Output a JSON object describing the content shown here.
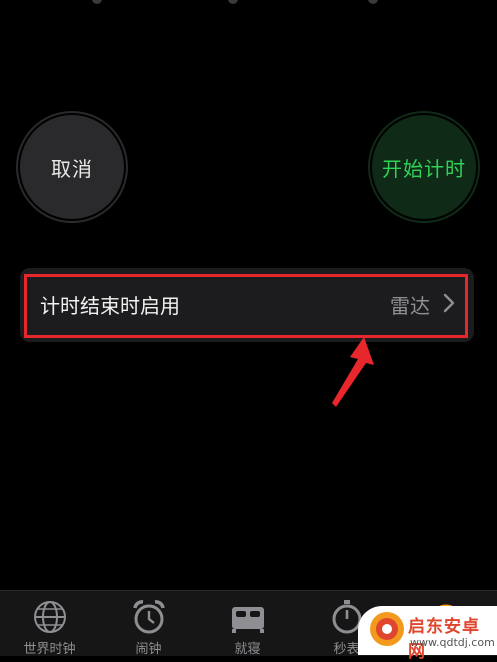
{
  "buttons": {
    "cancel_label": "取消",
    "start_label": "开始计时"
  },
  "timer_end_option": {
    "label": "计时结束时启用",
    "value": "雷达"
  },
  "tab_bar": {
    "items": [
      {
        "label": "世界时钟",
        "icon": "globe-icon"
      },
      {
        "label": "闹钟",
        "icon": "alarm-clock-icon"
      },
      {
        "label": "就寝",
        "icon": "bed-icon"
      },
      {
        "label": "秒表",
        "icon": "stopwatch-icon"
      },
      {
        "label": "",
        "icon": "timer-icon",
        "selected": true
      }
    ]
  },
  "watermark": {
    "title": "启东安卓网",
    "url": "www.qdtdj.com"
  },
  "colors": {
    "background": "#000000",
    "start_green": "#30d158",
    "annotation_red": "#e8272c",
    "timer_orange": "#ff9f0a"
  }
}
